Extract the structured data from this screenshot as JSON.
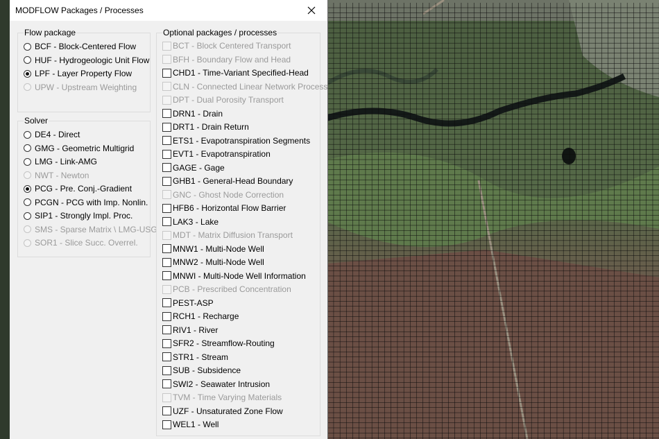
{
  "dialog": {
    "title": "MODFLOW Packages / Processes",
    "flow_group": {
      "label": "Flow package",
      "items": [
        {
          "label": "BCF - Block-Centered Flow",
          "selected": false,
          "enabled": true
        },
        {
          "label": "HUF - Hydrogeologic Unit Flow",
          "selected": false,
          "enabled": true
        },
        {
          "label": "LPF - Layer Property Flow",
          "selected": true,
          "enabled": true
        },
        {
          "label": "UPW - Upstream Weighting",
          "selected": false,
          "enabled": false
        }
      ]
    },
    "solver_group": {
      "label": "Solver",
      "items": [
        {
          "label": "DE4 - Direct",
          "selected": false,
          "enabled": true
        },
        {
          "label": "GMG - Geometric Multigrid",
          "selected": false,
          "enabled": true
        },
        {
          "label": "LMG - Link-AMG",
          "selected": false,
          "enabled": true
        },
        {
          "label": "NWT - Newton",
          "selected": false,
          "enabled": false
        },
        {
          "label": "PCG - Pre. Conj.-Gradient",
          "selected": true,
          "enabled": true
        },
        {
          "label": "PCGN - PCG with Imp. Nonlin.",
          "selected": false,
          "enabled": true
        },
        {
          "label": "SIP1 - Strongly Impl. Proc.",
          "selected": false,
          "enabled": true
        },
        {
          "label": "SMS - Sparse Matrix \\ LMG-USG",
          "selected": false,
          "enabled": false
        },
        {
          "label": "SOR1 - Slice Succ. Overrel.",
          "selected": false,
          "enabled": false
        }
      ]
    },
    "optional_group": {
      "label": "Optional packages / processes",
      "items": [
        {
          "label": "BCT - Block Centered Transport",
          "checked": false,
          "enabled": false
        },
        {
          "label": "BFH - Boundary Flow and Head",
          "checked": false,
          "enabled": false
        },
        {
          "label": "CHD1 - Time-Variant Specified-Head",
          "checked": false,
          "enabled": true
        },
        {
          "label": "CLN - Connected Linear Network Process",
          "checked": false,
          "enabled": false
        },
        {
          "label": "DPT - Dual Porosity Transport",
          "checked": false,
          "enabled": false
        },
        {
          "label": "DRN1 - Drain",
          "checked": false,
          "enabled": true
        },
        {
          "label": "DRT1 - Drain Return",
          "checked": false,
          "enabled": true
        },
        {
          "label": "ETS1 - Evapotranspiration Segments",
          "checked": false,
          "enabled": true
        },
        {
          "label": "EVT1 - Evapotranspiration",
          "checked": false,
          "enabled": true
        },
        {
          "label": "GAGE - Gage",
          "checked": false,
          "enabled": true
        },
        {
          "label": "GHB1 - General-Head Boundary",
          "checked": false,
          "enabled": true
        },
        {
          "label": "GNC - Ghost Node Correction",
          "checked": false,
          "enabled": false
        },
        {
          "label": "HFB6 - Horizontal Flow Barrier",
          "checked": false,
          "enabled": true
        },
        {
          "label": "LAK3 - Lake",
          "checked": false,
          "enabled": true
        },
        {
          "label": "MDT - Matrix Diffusion Transport",
          "checked": false,
          "enabled": false
        },
        {
          "label": "MNW1 - Multi-Node Well",
          "checked": false,
          "enabled": true
        },
        {
          "label": "MNW2 - Multi-Node Well",
          "checked": false,
          "enabled": true
        },
        {
          "label": "MNWI - Multi-Node Well Information",
          "checked": false,
          "enabled": true
        },
        {
          "label": "PCB - Prescribed Concentration",
          "checked": false,
          "enabled": false
        },
        {
          "label": "PEST-ASP",
          "checked": false,
          "enabled": true
        },
        {
          "label": "RCH1 - Recharge",
          "checked": false,
          "enabled": true
        },
        {
          "label": "RIV1 - River",
          "checked": false,
          "enabled": true
        },
        {
          "label": "SFR2 - Streamflow-Routing",
          "checked": false,
          "enabled": true
        },
        {
          "label": "STR1 - Stream",
          "checked": false,
          "enabled": true
        },
        {
          "label": "SUB - Subsidence",
          "checked": false,
          "enabled": true
        },
        {
          "label": "SWI2 - Seawater Intrusion",
          "checked": false,
          "enabled": true
        },
        {
          "label": "TVM - Time Varying Materials",
          "checked": false,
          "enabled": false
        },
        {
          "label": "UZF - Unsaturated Zone Flow",
          "checked": false,
          "enabled": true
        },
        {
          "label": "WEL1 - Well",
          "checked": false,
          "enabled": true
        }
      ]
    }
  }
}
